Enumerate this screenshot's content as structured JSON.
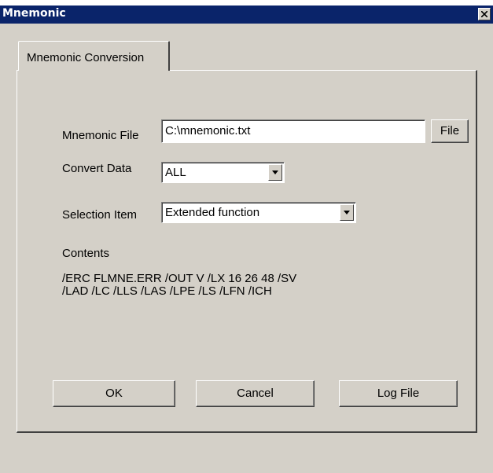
{
  "window": {
    "title": "Mnemonic"
  },
  "tabs": [
    {
      "label": "Mnemonic Conversion",
      "active": true
    }
  ],
  "form": {
    "mnemonic_file": {
      "label": "Mnemonic File",
      "value": "C:\\mnemonic.txt",
      "button_label": "File"
    },
    "convert_data": {
      "label": "Convert Data",
      "selected": "ALL"
    },
    "selection_item": {
      "label": "Selection Item",
      "selected": "Extended function"
    },
    "contents": {
      "label": "Contents",
      "lines": [
        "/ERC FLMNE.ERR /OUT V /LX 16 26 48 /SV",
        "/LAD /LC /LLS /LAS /LPE /LS /LFN /ICH"
      ]
    }
  },
  "buttons": {
    "ok": "OK",
    "cancel": "Cancel",
    "log_file": "Log File"
  },
  "icons": {
    "close": "close-icon",
    "dropdown": "chevron-down-icon"
  },
  "colors": {
    "titlebar": "#0a246a",
    "face": "#d4d0c8",
    "field": "#ffffff"
  }
}
